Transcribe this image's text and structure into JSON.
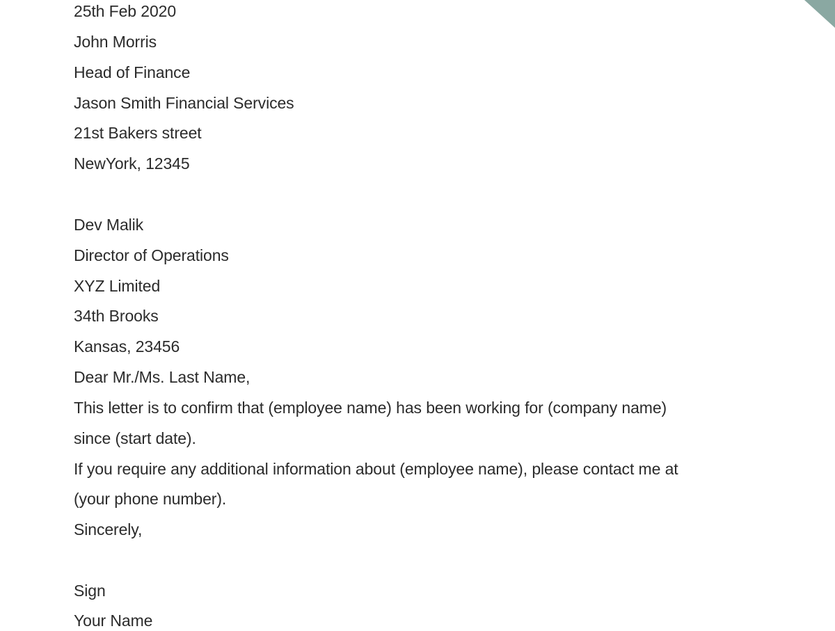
{
  "letter": {
    "date": "25th Feb 2020",
    "sender": {
      "name": "John Morris",
      "title": "Head of Finance",
      "company": "Jason Smith Financial Services",
      "street": "21st Bakers street",
      "city": "NewYork, 12345"
    },
    "recipient": {
      "name": "Dev Malik",
      "title": "Director of Operations",
      "company": "XYZ Limited",
      "street": "34th Brooks",
      "city": "Kansas, 23456"
    },
    "salutation": "Dear Mr./Ms. Last Name,",
    "body": [
      "This letter is to confirm that (employee name) has been working for (company name)",
      "since (start date).",
      "If you require any additional information about (employee name), please contact me at",
      "(your phone number)."
    ],
    "closing": "Sincerely,",
    "signature": "Sign",
    "signer_name": "Your Name"
  },
  "colors": {
    "accent": "#8aa8a2",
    "text": "#2b2b2b"
  }
}
